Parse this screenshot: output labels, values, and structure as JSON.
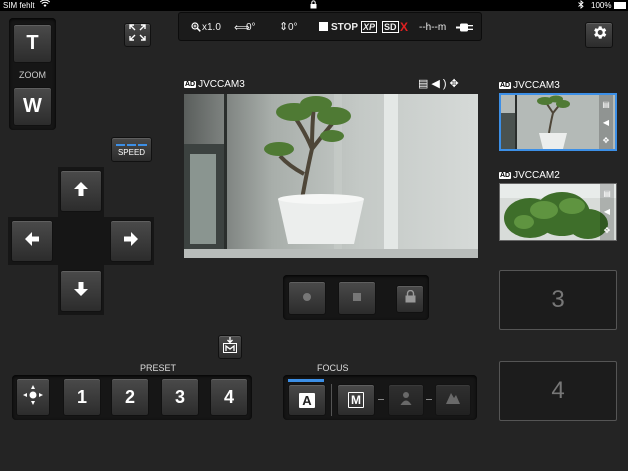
{
  "statusbar": {
    "carrier": "SIM fehlt",
    "battery": "100%"
  },
  "zoom": {
    "tele_label": "T",
    "wide_label": "W",
    "label": "ZOOM"
  },
  "topbar": {
    "zoom_value": "x1.0",
    "pan_value": "0°",
    "tilt_value": "0°",
    "rec_status": "STOP",
    "quality": "XP",
    "media": "SD",
    "media_error": "X",
    "remaining": "--h--m"
  },
  "speed": {
    "label": "SPEED",
    "level_bars": 3
  },
  "preset": {
    "label": "PRESET",
    "buttons": [
      "1",
      "2",
      "3",
      "4"
    ]
  },
  "main_camera": {
    "badge": "AD",
    "name": "JVCCAM3"
  },
  "focus": {
    "label": "FOCUS",
    "auto_label": "A",
    "manual_label": "M",
    "mode": "auto"
  },
  "cameras": [
    {
      "badge": "AD",
      "name": "JVCCAM3",
      "selected": true
    },
    {
      "badge": "AD",
      "name": "JVCCAM2",
      "selected": false
    }
  ],
  "slots": [
    "3",
    "4"
  ],
  "colors": {
    "accent": "#3c8fe6",
    "rec_error": "#e02020",
    "background": "#242424"
  }
}
